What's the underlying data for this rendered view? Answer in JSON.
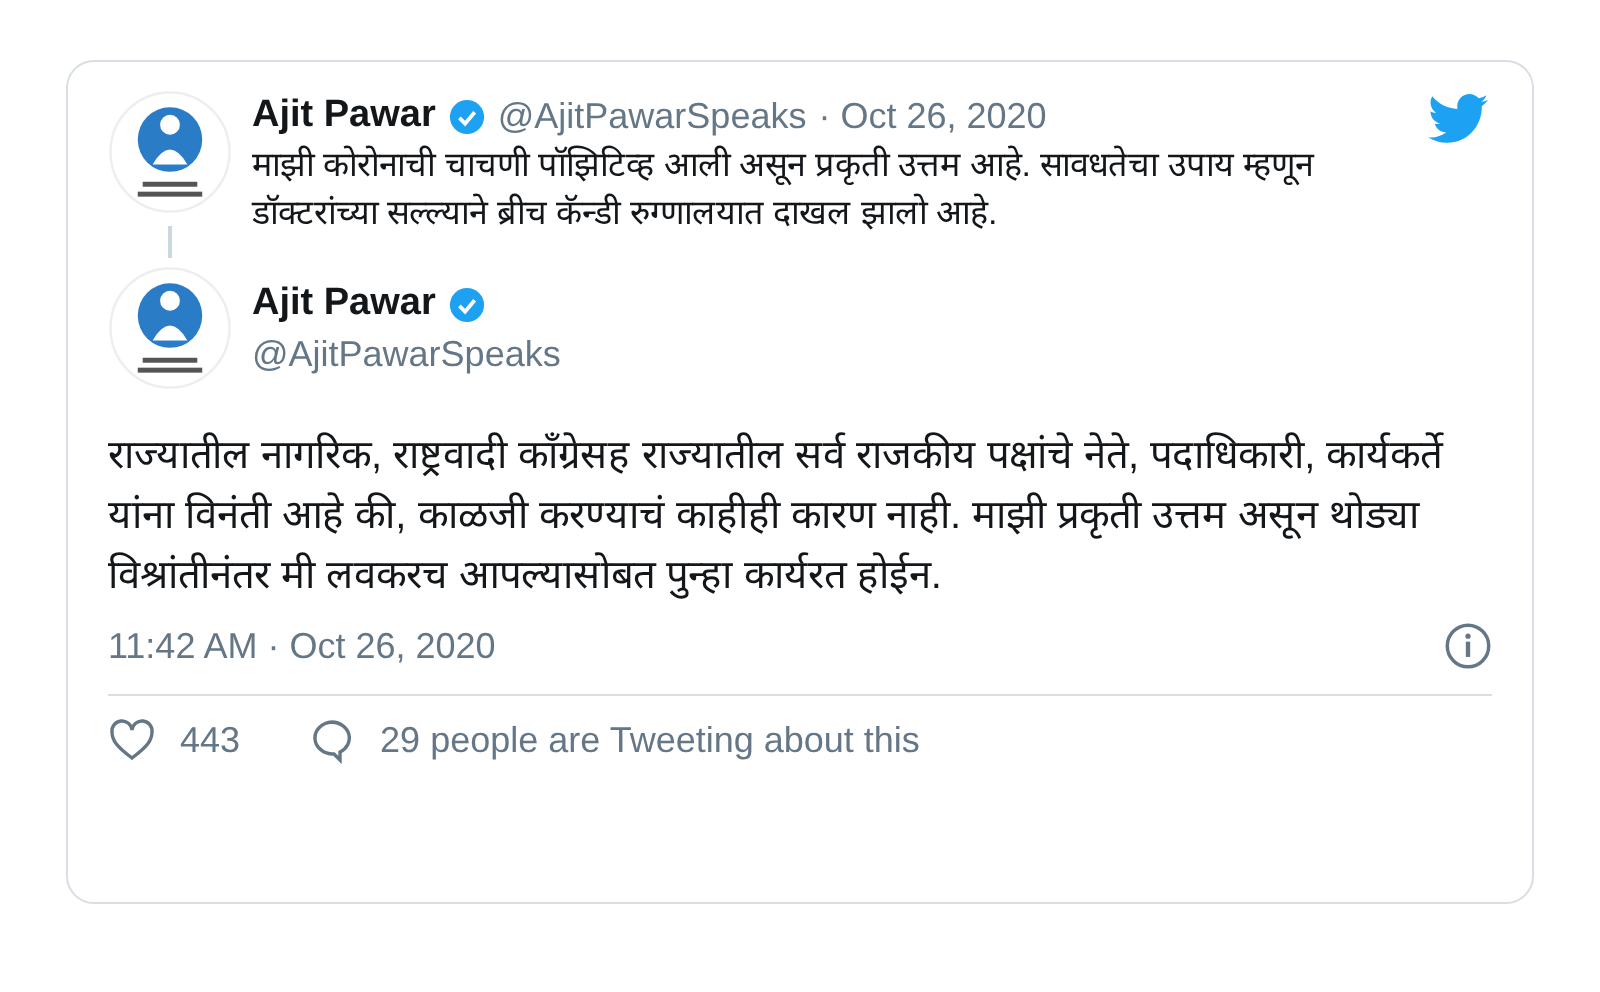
{
  "quoted_tweet": {
    "author": "Ajit Pawar",
    "verified": true,
    "handle": "@AjitPawarSpeaks",
    "time": "· Oct 26, 2020",
    "text": "माझी कोरोनाची चाचणी पॉझिटिव्ह आली असून प्रकृती उत्तम आहे. सावधतेचा उपाय म्हणून डॉक्टरांच्या सल्ल्याने ब्रीच कॅन्डी रुग्णालयात दाखल झालो आहे."
  },
  "tweet": {
    "author": "Ajit Pawar",
    "verified": true,
    "handle": "@AjitPawarSpeaks",
    "text": "राज्यातील नागरिक, राष्ट्रवादी काँग्रेसह राज्यातील सर्व राजकीय पक्षांचे नेते, पदाधिकारी, कार्यकर्ते यांना विनंती आहे की, काळजी करण्याचं काहीही कारण नाही. माझी प्रकृती उत्तम असून थोड्या विश्रांतीनंतर मी लवकरच आपल्यासोबत पुन्हा कार्यरत होईन.",
    "timestamp": "11:42 AM · Oct 26, 2020"
  },
  "actions": {
    "likes": "443",
    "discussion": "29 people are Tweeting about this"
  }
}
